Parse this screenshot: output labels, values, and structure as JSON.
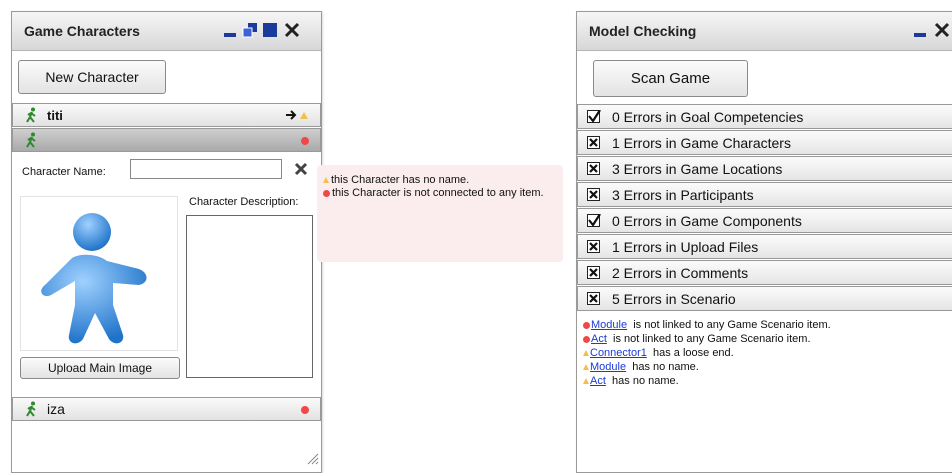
{
  "left_window": {
    "title": "Game Characters",
    "new_button": "New Character",
    "characters": [
      {
        "name": "titi"
      },
      {
        "name": ""
      },
      {
        "name": "iza"
      }
    ],
    "name_label": "Character Name:",
    "name_value": "",
    "description_label": "Character Description:",
    "upload_button": "Upload Main Image"
  },
  "tooltip": {
    "lines": [
      "this Character  has no name.",
      "this Character  is not connected to any item."
    ]
  },
  "right_window": {
    "title": "Model Checking",
    "scan_button": "Scan Game",
    "checks": [
      {
        "label": "0 Errors in Goal Competencies",
        "state": "ok"
      },
      {
        "label": "1 Errors in Game Characters",
        "state": "error"
      },
      {
        "label": "3 Errors in Game Locations",
        "state": "error"
      },
      {
        "label": "3 Errors in Participants",
        "state": "error"
      },
      {
        "label": "0 Errors in Game Components",
        "state": "ok"
      },
      {
        "label": "1 Errors in Upload Files",
        "state": "error"
      },
      {
        "label": "2 Errors in Comments",
        "state": "error"
      },
      {
        "label": "5 Errors in Scenario",
        "state": "error"
      }
    ],
    "messages": [
      {
        "link": "Module",
        "text": "is not linked to any Game Scenario item."
      },
      {
        "link": "Act",
        "text": "is not linked to any Game Scenario item."
      },
      {
        "link": "Connector1",
        "text": "has a loose end."
      },
      {
        "link": "Module",
        "text": "has no name."
      },
      {
        "link": "Act",
        "text": "has no name."
      }
    ]
  },
  "colors": {
    "error": "#f04848",
    "warning": "#f2c04a",
    "link": "#1a3bd6",
    "tooltip_bg": "#fbecee"
  }
}
